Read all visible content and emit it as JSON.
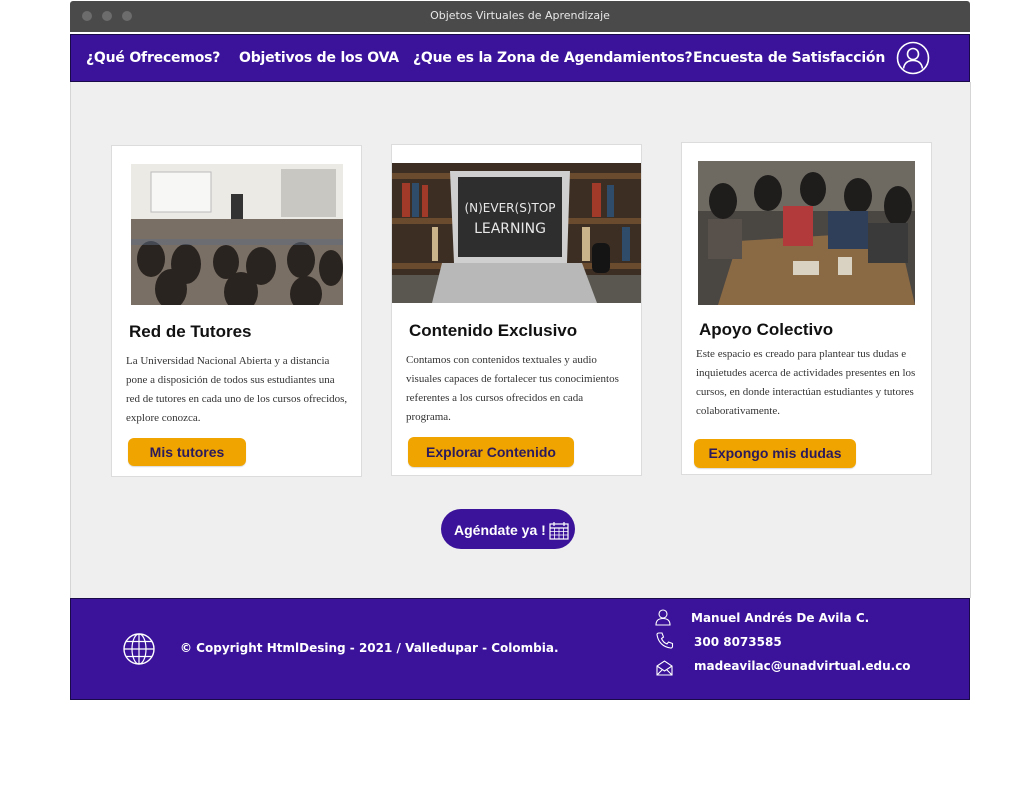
{
  "window": {
    "title": "Objetos Virtuales de Aprendizaje"
  },
  "nav": {
    "items": [
      {
        "label": "¿Qué Ofrecemos?"
      },
      {
        "label": "Objetivos de los OVA"
      },
      {
        "label": "¿Que es la Zona de Agendamientos?"
      },
      {
        "label": "Encuesta de Satisfacción"
      }
    ],
    "user_icon": "user-icon"
  },
  "cards": [
    {
      "title": "Red de Tutores",
      "text": "La Universidad Nacional Abierta y a distancia pone a disposición de todos sus estudiantes una red de tutores en cada uno de los cursos ofrecidos,  explore conozca.",
      "button": "Mis tutores"
    },
    {
      "title": "Contenido Exclusivo",
      "text": "Contamos con contenidos textuales y audio visuales capaces de fortalecer tus conocimientos referentes a los cursos ofrecidos en cada programa.",
      "button": "Explorar Contenido",
      "screen_text_1": "(N)EVER(S)TOP",
      "screen_text_2": "LEARNING"
    },
    {
      "title": "Apoyo Colectivo",
      "text": "Este espacio es creado para plantear tus dudas e inquietudes acerca de actividades presentes en los cursos, en donde interactúan estudiantes y tutores colaborativamente.",
      "button": "Expongo mis dudas"
    }
  ],
  "cta": {
    "label": "Agéndate ya !",
    "icon": "calendar-icon"
  },
  "footer": {
    "copyright": "© Copyright HtmlDesing - 2021 / Valledupar - Colombia.",
    "contact": {
      "name": "Manuel Andrés De Avila C.",
      "phone": "300 8073585",
      "email": "madeavilac@unadvirtual.edu.co"
    }
  },
  "colors": {
    "brand": "#3a139a",
    "accent": "#f0a400",
    "background": "#efefef"
  }
}
